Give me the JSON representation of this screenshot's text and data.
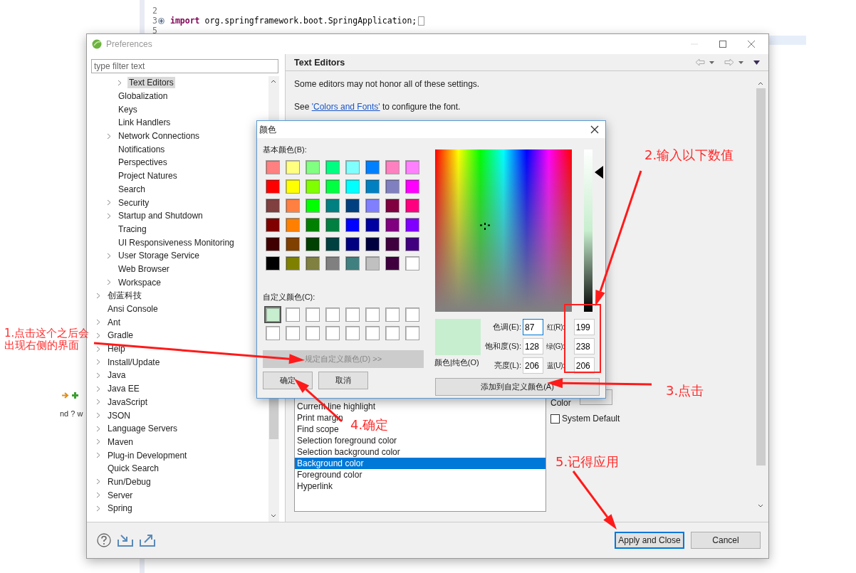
{
  "editor": {
    "lines": [
      {
        "number": "2"
      },
      {
        "number": "3",
        "collapsed": true,
        "keyword": "import",
        "code": "org.springframework.boot.SpringApplication;"
      },
      {
        "number": "5"
      }
    ]
  },
  "side_panel": {
    "text": "nd ? w"
  },
  "preferences": {
    "title": "Preferences",
    "filter": {
      "placeholder": "type filter text"
    },
    "tree": [
      {
        "children": [
          {
            "children": [
              {
                "label": "Text Editors",
                "expandable": true,
                "selected": true
              }
            ]
          },
          {
            "label": "Globalization",
            "expandable": false,
            "selected": false
          },
          {
            "label": "Keys",
            "expandable": false,
            "selected": false
          },
          {
            "label": "Link Handlers",
            "expandable": false,
            "selected": false
          },
          {
            "label": "Network Connections",
            "expandable": true,
            "selected": false
          },
          {
            "label": "Notifications",
            "expandable": false,
            "selected": false
          },
          {
            "label": "Perspectives",
            "expandable": false,
            "selected": false
          },
          {
            "label": "Project Natures",
            "expandable": false,
            "selected": false
          },
          {
            "label": "Search",
            "expandable": false,
            "selected": false
          },
          {
            "label": "Security",
            "expandable": true,
            "selected": false
          },
          {
            "label": "Startup and Shutdown",
            "expandable": true,
            "selected": false
          },
          {
            "label": "Tracing",
            "expandable": false,
            "selected": false
          },
          {
            "label": "UI Responsiveness Monitoring",
            "expandable": false,
            "selected": false
          },
          {
            "label": "User Storage Service",
            "expandable": true,
            "selected": false
          },
          {
            "label": "Web Browser",
            "expandable": false,
            "selected": false
          },
          {
            "label": "Workspace",
            "expandable": true,
            "selected": false
          }
        ]
      },
      {
        "label": "创蓝科技",
        "expandable": true,
        "selected": false
      },
      {
        "label": "Ansi Console",
        "expandable": false,
        "selected": false
      },
      {
        "label": "Ant",
        "expandable": true,
        "selected": false
      },
      {
        "label": "Gradle",
        "expandable": true,
        "selected": false
      },
      {
        "label": "Help",
        "expandable": true,
        "selected": false
      },
      {
        "label": "Install/Update",
        "expandable": true,
        "selected": false
      },
      {
        "label": "Java",
        "expandable": true,
        "selected": false
      },
      {
        "label": "Java EE",
        "expandable": true,
        "selected": false
      },
      {
        "label": "JavaScript",
        "expandable": true,
        "selected": false
      },
      {
        "label": "JSON",
        "expandable": true,
        "selected": false
      },
      {
        "label": "Language Servers",
        "expandable": true,
        "selected": false
      },
      {
        "label": "Maven",
        "expandable": true,
        "selected": false
      },
      {
        "label": "Plug-in Development",
        "expandable": true,
        "selected": false
      },
      {
        "label": "Quick Search",
        "expandable": false,
        "selected": false
      },
      {
        "label": "Run/Debug",
        "expandable": true,
        "selected": false
      },
      {
        "label": "Server",
        "expandable": true,
        "selected": false
      },
      {
        "label": "Spring",
        "expandable": true,
        "selected": false
      }
    ],
    "page": {
      "title": "Text Editors",
      "note": "Some editors may not honor all of these settings.",
      "link_line": {
        "before": "See ",
        "link": "'Colors and Fonts'",
        "after": " to configure the font."
      },
      "color_options": [
        {
          "label": "Current line highlight",
          "selected": false
        },
        {
          "label": "Print margin",
          "selected": false
        },
        {
          "label": "Find scope",
          "selected": false
        },
        {
          "label": "Selection foreground color",
          "selected": false
        },
        {
          "label": "Selection background color",
          "selected": false
        },
        {
          "label": "Background color",
          "selected": true
        },
        {
          "label": "Foreground color",
          "selected": false
        },
        {
          "label": "Hyperlink",
          "selected": false
        }
      ],
      "color_label": "Color",
      "system_default": {
        "label": "System Default",
        "checked": false
      }
    },
    "buttons": [
      {
        "label": "Apply and Close",
        "default": true
      },
      {
        "label": "Cancel",
        "default": false
      }
    ]
  },
  "color_dialog": {
    "title": "颜色",
    "basic_label": "基本颜色(B):",
    "basic_colors": [
      {
        "color": "#ff8080"
      },
      {
        "color": "#ffff80"
      },
      {
        "color": "#80ff80"
      },
      {
        "color": "#00ff80"
      },
      {
        "color": "#80ffff"
      },
      {
        "color": "#0080ff"
      },
      {
        "color": "#ff80c0"
      },
      {
        "color": "#ff80ff"
      },
      {
        "color": "#ff0000"
      },
      {
        "color": "#ffff00"
      },
      {
        "color": "#80ff00"
      },
      {
        "color": "#00ff40"
      },
      {
        "color": "#00ffff"
      },
      {
        "color": "#0080c0"
      },
      {
        "color": "#8080c0"
      },
      {
        "color": "#ff00ff"
      },
      {
        "color": "#804040"
      },
      {
        "color": "#ff8040"
      },
      {
        "color": "#00ff00"
      },
      {
        "color": "#008080"
      },
      {
        "color": "#004080"
      },
      {
        "color": "#8080ff"
      },
      {
        "color": "#800040"
      },
      {
        "color": "#ff0080"
      },
      {
        "color": "#800000"
      },
      {
        "color": "#ff8000"
      },
      {
        "color": "#008000"
      },
      {
        "color": "#008040"
      },
      {
        "color": "#0000ff"
      },
      {
        "color": "#0000a0"
      },
      {
        "color": "#800080"
      },
      {
        "color": "#8000ff"
      },
      {
        "color": "#400000"
      },
      {
        "color": "#804000"
      },
      {
        "color": "#004000"
      },
      {
        "color": "#004040"
      },
      {
        "color": "#000080"
      },
      {
        "color": "#000040"
      },
      {
        "color": "#400040"
      },
      {
        "color": "#400080"
      },
      {
        "color": "#000000"
      },
      {
        "color": "#808000"
      },
      {
        "color": "#808040"
      },
      {
        "color": "#808080"
      },
      {
        "color": "#408080"
      },
      {
        "color": "#c0c0c0"
      },
      {
        "color": "#400040"
      },
      {
        "color": "#ffffff"
      }
    ],
    "custom_label": "自定义颜色(C):",
    "custom_colors": [
      {
        "color": "#c7eece",
        "selected": true
      },
      {
        "color": "#ffffff",
        "selected": false
      },
      {
        "color": "#ffffff",
        "selected": false
      },
      {
        "color": "#ffffff",
        "selected": false
      },
      {
        "color": "#ffffff",
        "selected": false
      },
      {
        "color": "#ffffff",
        "selected": false
      },
      {
        "color": "#ffffff",
        "selected": false
      },
      {
        "color": "#ffffff",
        "selected": false
      },
      {
        "color": "#ffffff",
        "selected": false
      },
      {
        "color": "#ffffff",
        "selected": false
      },
      {
        "color": "#ffffff",
        "selected": false
      },
      {
        "color": "#ffffff",
        "selected": false
      },
      {
        "color": "#ffffff",
        "selected": false
      },
      {
        "color": "#ffffff",
        "selected": false
      },
      {
        "color": "#ffffff",
        "selected": false
      },
      {
        "color": "#ffffff",
        "selected": false
      }
    ],
    "define_button": {
      "label": "规定自定义颜色(D) >>",
      "disabled": true
    },
    "ok_button": "确定",
    "cancel_button": "取消",
    "preview": {
      "color": "#c7eece",
      "label": "颜色|纯色(O)"
    },
    "luminance": {
      "level": 0.86
    },
    "hsl_fields": [
      {
        "label": "色调(E):",
        "value": "87"
      },
      {
        "label": "饱和度(S):",
        "value": "128"
      },
      {
        "label": "亮度(L):",
        "value": "206"
      }
    ],
    "rgb_fields": [
      {
        "label": "红(R):",
        "value": "199"
      },
      {
        "label": "绿(G):",
        "value": "238"
      },
      {
        "label": "蓝(U):",
        "value": "206"
      }
    ],
    "add_button": "添加到自定义颜色(A)"
  },
  "annotations": [
    {
      "text": "1.点击这个之后会出现右侧的界面"
    },
    {
      "text": "2.输入以下数值"
    },
    {
      "text": "3.点击"
    },
    {
      "text": "4.确定"
    },
    {
      "text": "5.记得应用"
    }
  ]
}
